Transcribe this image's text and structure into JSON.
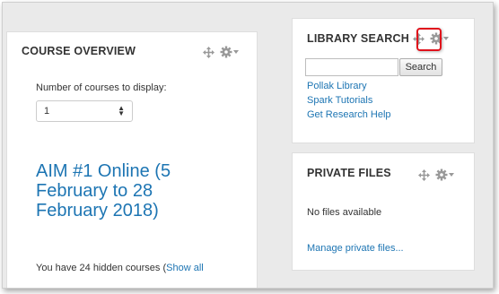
{
  "course_overview": {
    "title": "COURSE OVERVIEW",
    "num_courses_label": "Number of courses to display:",
    "num_courses_value": "1",
    "course_name": "AIM #1 Online (5 February to 28 February 2018)",
    "hidden_text": "You have 24 hidden courses (",
    "show_all_label": "Show all"
  },
  "library_search": {
    "title": "LIBRARY SEARCH",
    "search_button": "Search",
    "search_value": "",
    "links": [
      "Pollak Library",
      "Spark Tutorials",
      "Get Research Help"
    ]
  },
  "private_files": {
    "title": "PRIVATE FILES",
    "empty_text": "No files available",
    "manage_link": "Manage private files..."
  },
  "colors": {
    "link": "#1d75b3",
    "highlight": "#e0111b",
    "background": "#eaeaea"
  }
}
